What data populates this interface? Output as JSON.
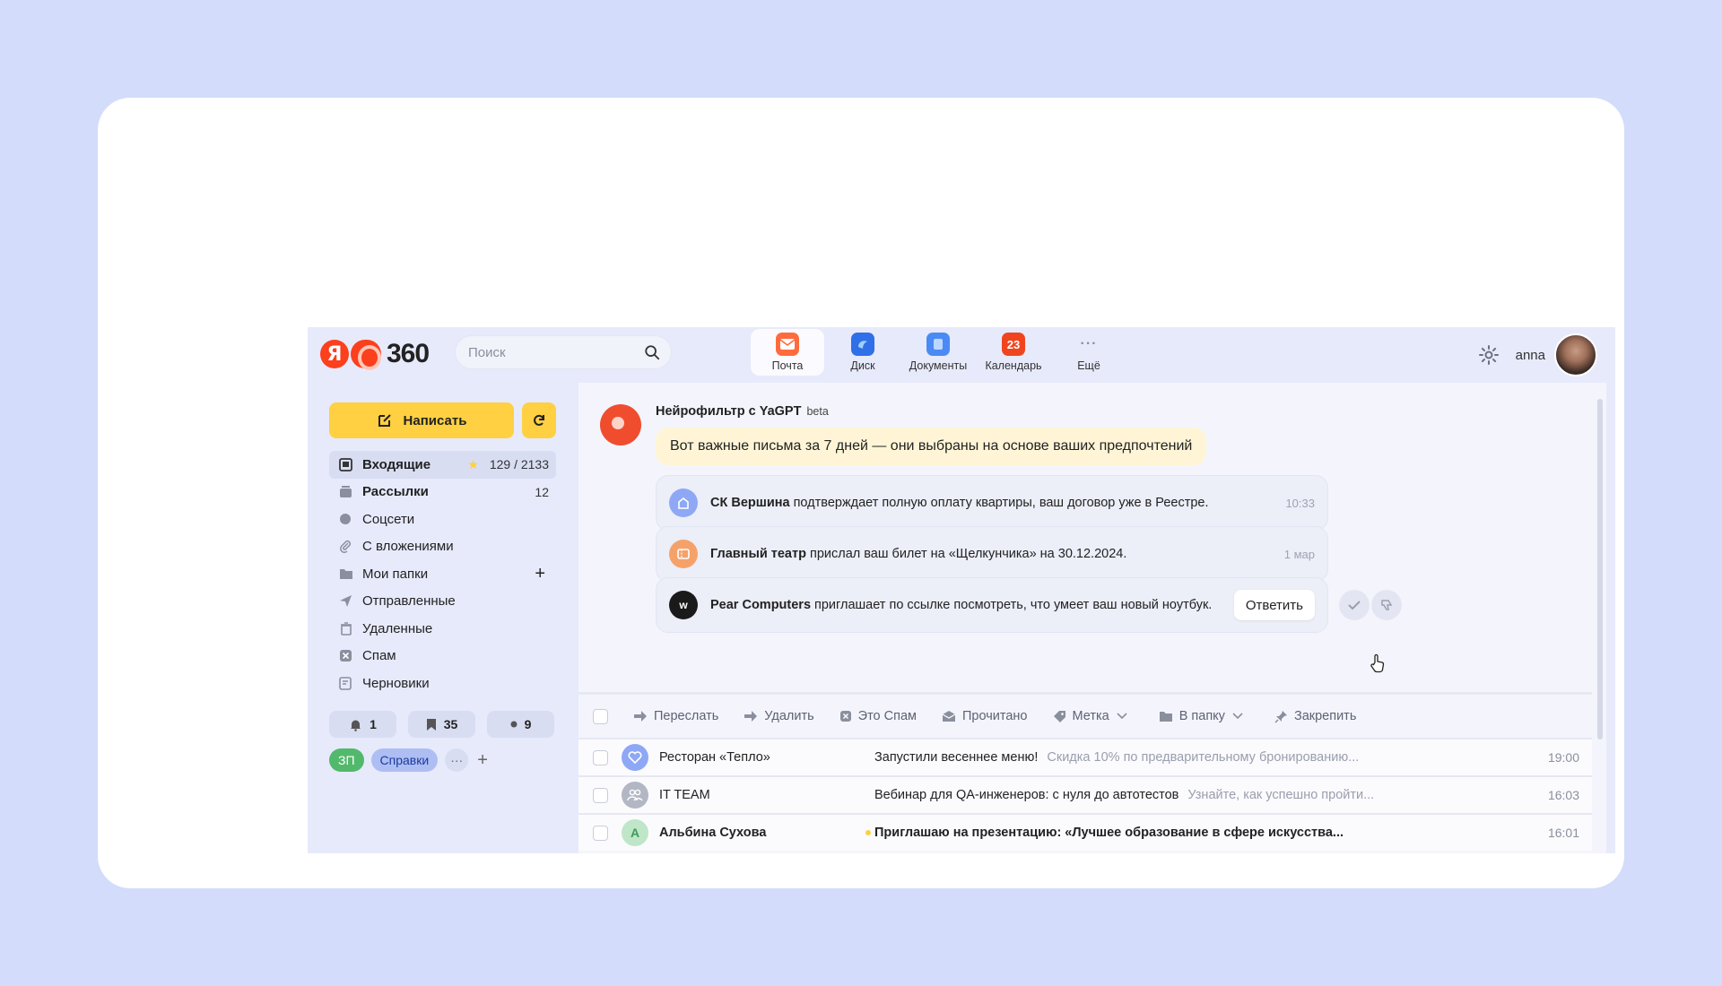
{
  "header": {
    "logo_text": "360",
    "logo_ya": "Я",
    "search_placeholder": "Поиск",
    "services": [
      {
        "label": "Почта",
        "icon": "mail-icon",
        "color": "#ff6b3d"
      },
      {
        "label": "Диск",
        "icon": "disk-icon",
        "color": "#2f6fe8"
      },
      {
        "label": "Документы",
        "icon": "documents-icon",
        "color": "#4a8af4"
      },
      {
        "label": "Календарь",
        "icon": "calendar-icon",
        "color": "#f0441f",
        "badge": "23"
      },
      {
        "label": "Ещё",
        "icon": "more-icon",
        "glyph": "···"
      }
    ],
    "username": "anna"
  },
  "sidebar": {
    "compose_label": "Написать",
    "folders": [
      {
        "label": "Входящие",
        "icon": "inbox-icon",
        "count": "129 / 2133"
      },
      {
        "label": "Рассылки",
        "icon": "newsletters-icon",
        "count": "12"
      },
      {
        "label": "Соцсети",
        "icon": "social-icon"
      },
      {
        "label": "С вложениями",
        "icon": "attachment-icon"
      },
      {
        "label": "Мои папки",
        "icon": "folders-icon",
        "plus": "+"
      },
      {
        "label": "Отправленные",
        "icon": "sent-icon"
      },
      {
        "label": "Удаленные",
        "icon": "trash-icon"
      },
      {
        "label": "Спам",
        "icon": "spam-icon"
      },
      {
        "label": "Черновики",
        "icon": "drafts-icon"
      }
    ],
    "counters": [
      {
        "icon": "bell-icon",
        "value": "1"
      },
      {
        "icon": "bookmark-icon",
        "value": "35"
      },
      {
        "icon": "dot-icon",
        "value": "9"
      }
    ],
    "tags": [
      {
        "label": "ЗП",
        "color": "#52b96c"
      },
      {
        "label": "Справки",
        "color": "#aebef3"
      }
    ],
    "tags_more": "···",
    "tags_add": "+"
  },
  "ai": {
    "title": "Нейрофильтр с YaGPT",
    "beta": "beta",
    "message": "Вот важные письма за 7 дней — они выбраны на основе ваших предпочтений",
    "cards": [
      {
        "sender": "СК Вершина",
        "text": "подтверждает полную оплату квартиры, ваш договор уже в Реестре.",
        "time": "10:33",
        "icon_color": "#8fa8f5"
      },
      {
        "sender": "Главный театр",
        "text": "прислал ваш билет на «Щелкунчика» на 30.12.2024.",
        "time": "1 мар",
        "icon_color": "#f5a26a"
      },
      {
        "sender": "Pear Computers",
        "text": "приглашает по ссылке посмотреть, что умеет ваш новый ноутбук.",
        "reply": "Ответить",
        "icon_letter": "w",
        "icon_color": "#1a1a1a"
      }
    ]
  },
  "toolbar": {
    "forward": "Переслать",
    "delete": "Удалить",
    "spam": "Это Спам",
    "read": "Прочитано",
    "label": "Метка",
    "move": "В папку",
    "pin": "Закрепить"
  },
  "messages": [
    {
      "from": "Ресторан «Тепло»",
      "subject": "Запустили весеннее меню!",
      "preview": "Скидка 10% по предварительному бронированию...",
      "time": "19:00",
      "avatar_color": "#8fa8f5"
    },
    {
      "from": "IT TEAM",
      "subject": "Вебинар для QA-инженеров: с нуля до автотестов",
      "preview": "Узнайте, как успешно пройти...",
      "time": "16:03",
      "avatar_color": "#b3b7c4"
    },
    {
      "from": "Альбина Сухова",
      "subject": "Приглашаю на презентацию: «Лучшее образование в сфере искусства...",
      "preview": "",
      "time": "16:01",
      "avatar_letter": "А",
      "avatar_color": "#bfe6c8",
      "unread": true
    }
  ]
}
